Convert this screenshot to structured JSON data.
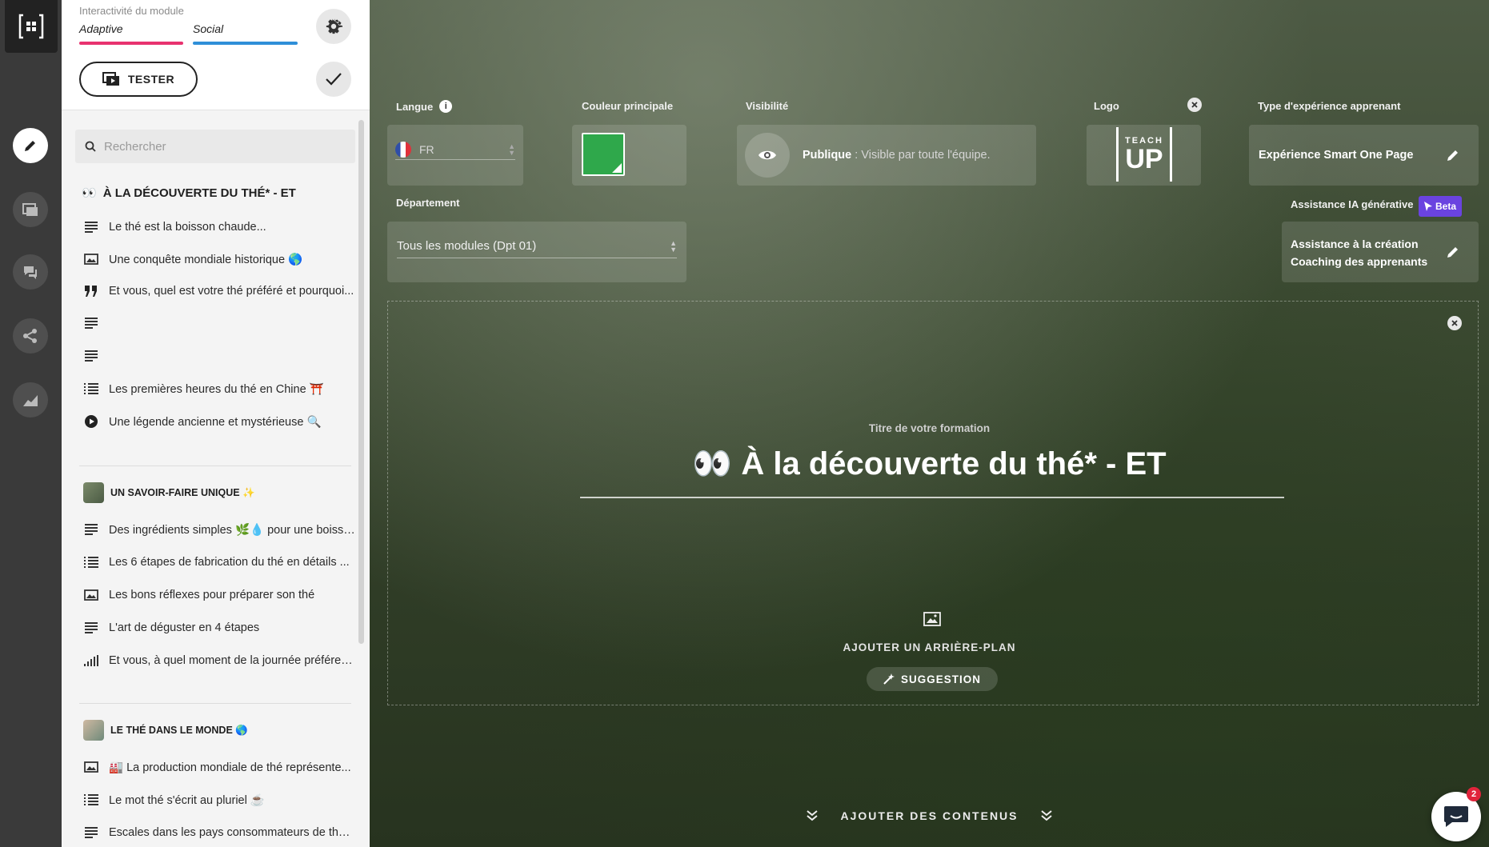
{
  "panel": {
    "interact_title": "Interactivité du module",
    "tabs": [
      {
        "label": "Adaptive",
        "color": "#e8326f"
      },
      {
        "label": "Social",
        "color": "#2f8fd8"
      }
    ],
    "tester_label": "TESTER",
    "search_placeholder": "Rechercher",
    "sections": [
      {
        "title": "À LA DÉCOUVERTE DU THÉ* - ET",
        "title_emoji": "👀",
        "items": [
          {
            "icon": "text-icon",
            "label": "Le thé est la boisson chaude..."
          },
          {
            "icon": "image-icon",
            "label": "Une conquête mondiale historique 🌎"
          },
          {
            "icon": "quote-icon",
            "label": "Et vous, quel est votre thé préféré et pourquoi..."
          },
          {
            "icon": "text-icon",
            "label": ""
          },
          {
            "icon": "text-icon",
            "label": ""
          },
          {
            "icon": "list-icon",
            "label": "Les premières heures du thé en Chine ⛩️"
          },
          {
            "icon": "play-icon",
            "label": "Une légende ancienne et mystérieuse 🔍"
          }
        ]
      },
      {
        "title": "UN SAVOIR-FAIRE UNIQUE ✨",
        "items": [
          {
            "icon": "text-icon",
            "label": "Des ingrédients simples 🌿💧 pour une boisson..."
          },
          {
            "icon": "list-icon",
            "label": "Les 6 étapes de fabrication du thé en détails ..."
          },
          {
            "icon": "image-icon",
            "label": "Les bons réflexes pour préparer son thé"
          },
          {
            "icon": "text-icon",
            "label": "L'art de déguster en 4 étapes"
          },
          {
            "icon": "poll-icon",
            "label": "Et vous, à quel moment de la journée préférez..."
          }
        ]
      },
      {
        "title": "LE THÉ DANS LE MONDE 🌎",
        "items": [
          {
            "icon": "image-icon",
            "label": "🏭 La production mondiale de thé représente..."
          },
          {
            "icon": "list-icon",
            "label": "Le mot thé s'écrit au pluriel ☕"
          },
          {
            "icon": "text-icon",
            "label": "Escales dans les pays consommateurs de thé ..."
          }
        ]
      }
    ]
  },
  "settings": {
    "langue_label": "Langue",
    "langue_value": "FR",
    "couleur_label": "Couleur principale",
    "couleur_value": "#2fa84b",
    "visibilite_label": "Visibilité",
    "visibilite_bold": "Publique",
    "visibilite_desc": " : Visible par toute l'équipe.",
    "logo_label": "Logo",
    "logo_text_top": "TEACH",
    "logo_text_bottom": "UP",
    "experience_label": "Type d'expérience apprenant",
    "experience_value": "Expérience Smart One Page",
    "departement_label": "Département",
    "departement_value": "Tous les modules (Dpt 01)",
    "ia_label": "Assistance IA générative",
    "ia_badge": "Beta",
    "ia_line1": "Assistance à la création",
    "ia_line2": "Coaching des apprenants"
  },
  "canvas": {
    "title_label": "Titre de votre formation",
    "title_emoji": "👀",
    "title": "À la découverte du thé* - ET",
    "add_background": "AJOUTER UN ARRIÈRE-PLAN",
    "suggestion": "SUGGESTION",
    "add_contents": "AJOUTER DES CONTENUS",
    "chat_badge": "2"
  }
}
